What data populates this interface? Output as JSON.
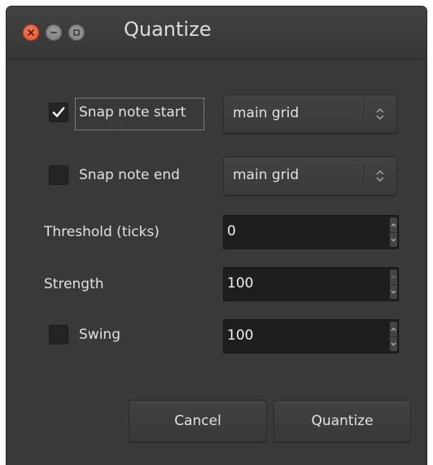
{
  "window": {
    "title": "Quantize"
  },
  "rows": {
    "snap_start": {
      "label": "Snap note start",
      "checked": true,
      "combo_value": "main grid"
    },
    "snap_end": {
      "label": "Snap note end",
      "checked": false,
      "combo_value": "main grid"
    },
    "threshold": {
      "label": "Threshold (ticks)",
      "value": "0"
    },
    "strength": {
      "label": "Strength",
      "value": "100"
    },
    "swing": {
      "label": "Swing",
      "checked": false,
      "value": "100"
    }
  },
  "buttons": {
    "cancel": "Cancel",
    "quantize": "Quantize"
  },
  "colors": {
    "close": "#e0522f",
    "background": "#393939",
    "field": "#1e1e1e"
  }
}
